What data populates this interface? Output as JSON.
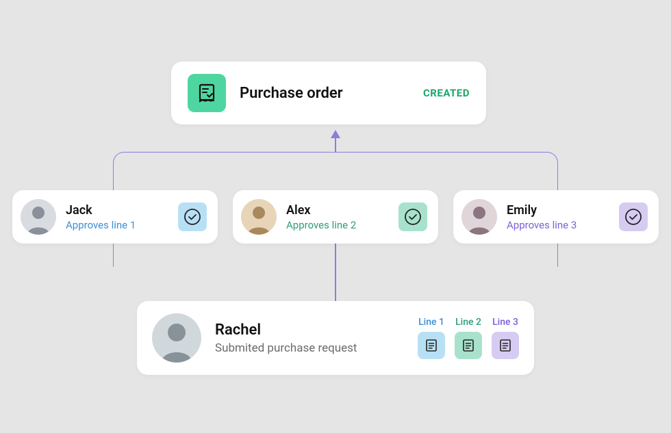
{
  "purchase_order": {
    "title": "Purchase order",
    "status": "CREATED"
  },
  "approvers": [
    {
      "name": "Jack",
      "action": "Approves line 1",
      "color": "blue"
    },
    {
      "name": "Alex",
      "action": "Approves line 2",
      "color": "green"
    },
    {
      "name": "Emily",
      "action": "Approves line 3",
      "color": "purple"
    }
  ],
  "submitter": {
    "name": "Rachel",
    "action": "Submited purchase request",
    "lines": [
      {
        "label": "Line 1",
        "color": "blue"
      },
      {
        "label": "Line 2",
        "color": "green"
      },
      {
        "label": "Line 3",
        "color": "purple"
      }
    ]
  }
}
